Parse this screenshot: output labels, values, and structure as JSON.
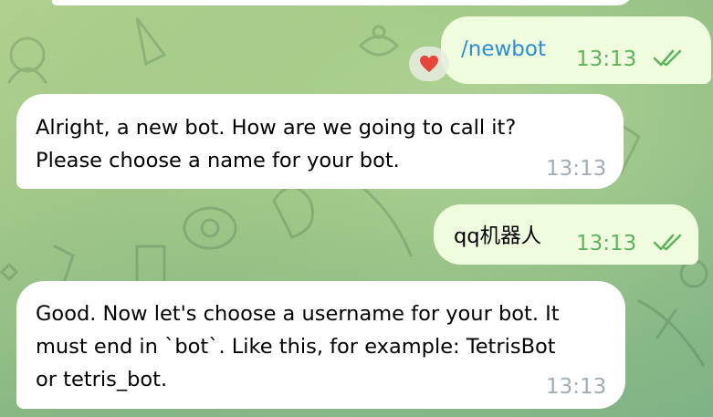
{
  "messages": [
    {
      "direction": "out",
      "text": "/newbot",
      "time": "13:13",
      "status": "read",
      "reaction": "heart"
    },
    {
      "direction": "in",
      "text": "Alright, a new bot. How are we going to call it?\nPlease choose a name for your bot.",
      "time": "13:13"
    },
    {
      "direction": "out",
      "text": "qq机器人",
      "time": "13:13",
      "status": "read"
    },
    {
      "direction": "in",
      "text": "Good. Now let's choose a username for your bot. It\nmust end in `bot`. Like this, for example: TetrisBot\nor tetris_bot.",
      "time": "13:13"
    }
  ],
  "colors": {
    "incoming_bubble": "#ffffff",
    "outgoing_bubble": "#effdde",
    "command_link": "#2a8ed1",
    "read_check": "#5fb35e",
    "time_in": "#a0acb6",
    "reaction_heart": "#e9443b"
  }
}
